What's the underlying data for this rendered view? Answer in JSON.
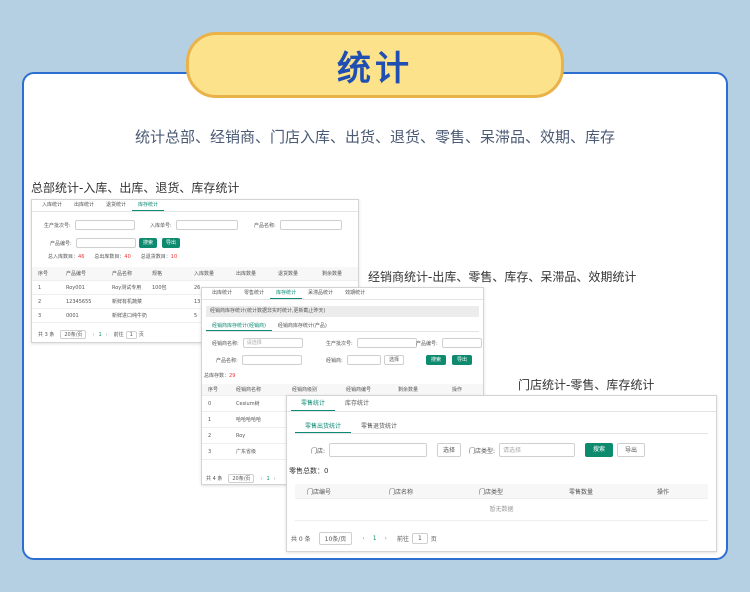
{
  "header": {
    "title": "统计"
  },
  "subtitle": "统计总部、经销商、门店入库、出货、退货、零售、呆滞品、效期、库存",
  "labels": {
    "hq": "总部统计-入库、出库、退货、库存统计",
    "dealer": "经销商统计-出库、零售、库存、呆滞品、效期统计",
    "store": "门店统计-零售、库存统计"
  },
  "hq": {
    "tabs": [
      "入库统计",
      "出库统计",
      "退货统计",
      "库存统计"
    ],
    "fields": {
      "batch": "生产批次号:",
      "inbound_no": "入库单号:",
      "product_name": "产品名称:",
      "product_no": "产品编号:"
    },
    "buttons": {
      "search": "搜索",
      "export": "导出"
    },
    "summary": {
      "in_label": "总入库数目：",
      "in_value": "46",
      "out_label": "总出库数目：",
      "out_value": "40",
      "ret_label": "总退货数目：",
      "ret_value": "10"
    },
    "columns": [
      "序号",
      "产品编号",
      "产品名称",
      "规格",
      "入库数量",
      "出库数量",
      "退货数量",
      "剩余数量"
    ],
    "rows": [
      [
        "1",
        "Roy001",
        "Roy测试专用",
        "100包",
        "26"
      ],
      [
        "2",
        "12345655",
        "新鲜有机蔬菜",
        "",
        "13"
      ],
      [
        "3",
        "0001",
        "新鲜进口纯牛奶",
        "",
        "5"
      ]
    ],
    "pagination": {
      "total": "共 3 条",
      "size": "20条/页",
      "page": "1",
      "goto": "前往",
      "goto_val": "1",
      "unit": "页"
    }
  },
  "dealer": {
    "tabs": [
      "出库统计",
      "零售统计",
      "库存统计",
      "呆滞品统计",
      "效期统计"
    ],
    "notice": "经销商库存统计(统计数据非实时统计,更新截止昨天)",
    "subtabs": [
      "经销商库存统计(经销商)",
      "经销商库存统计(产品)"
    ],
    "fields": {
      "dealer": "经销商名称:",
      "dealer_ph": "请选择",
      "batch": "生产批次号:",
      "product_no": "产品编号:",
      "product_name": "产品名称:",
      "owner": "经销商:"
    },
    "buttons": {
      "select": "选择",
      "search": "搜索",
      "export": "导出"
    },
    "total_label": "总库存数：",
    "total_value": "29",
    "columns": [
      "序号",
      "经销商名称",
      "经销商级别",
      "经销商编号",
      "剩余数量",
      "操作"
    ],
    "rows": [
      [
        "0",
        "Cesium树"
      ],
      [
        "1",
        "哈哈哈哈哈"
      ],
      [
        "2",
        "Roy"
      ],
      [
        "3",
        "广东省级"
      ]
    ],
    "pagination": {
      "total": "共 4 条",
      "size": "20条/页",
      "page": "1"
    }
  },
  "store": {
    "tabs": [
      "零售统计",
      "库存统计"
    ],
    "subtabs": [
      "零售出货统计",
      "零售退货统计"
    ],
    "fields": {
      "store": "门店:",
      "store_type": "门店类型:",
      "store_type_ph": "请选择"
    },
    "buttons": {
      "select": "选择",
      "search": "搜索",
      "export": "导出"
    },
    "total_label": "零售总数：",
    "total_value": "0",
    "columns": [
      "门店编号",
      "门店名称",
      "门店类型",
      "零售数量",
      "操作"
    ],
    "empty": "暂无数据",
    "pagination": {
      "total": "共 0 条",
      "size": "10条/页",
      "page": "1",
      "goto": "前往",
      "goto_val": "1",
      "unit": "页"
    }
  }
}
